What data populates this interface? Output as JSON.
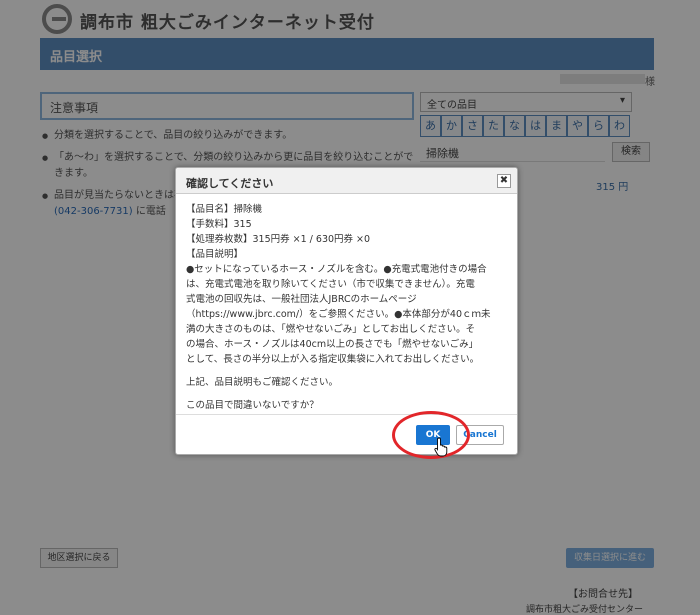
{
  "header": {
    "site_title": "調布市 粗大ごみインターネット受付"
  },
  "section": {
    "title": "品目選択"
  },
  "user": {
    "suffix": "様"
  },
  "notice": {
    "title": "注意事項",
    "bullets": [
      "分類を選択することで、品目の絞り込みができます。",
      "「あ〜わ」を選択することで、分類の絞り込みから更に品目を絞り込むことができます。",
      "品目が見当たらないときは事"
    ],
    "phone": "(042-306-7731)",
    "phone_suffix": "に電話"
  },
  "filter": {
    "category": "全ての品目",
    "kana": [
      "あ",
      "か",
      "さ",
      "た",
      "な",
      "は",
      "ま",
      "や",
      "ら",
      "わ"
    ],
    "search_value": "掃除機",
    "search_button": "検索",
    "price": "315 円"
  },
  "footer": {
    "back_button": "地区選択に戻る",
    "next_button": "収集日選択に進む",
    "contact_title": "【お問合せ先】",
    "contact_name": "調布市粗大ごみ受付センター"
  },
  "dialog": {
    "title": "確認してください",
    "item_name": "【品目名】掃除機",
    "fee": "【手数料】315",
    "tickets": "【処理券枚数】315円券 ×1 / 630円券 ×0",
    "desc_label": "【品目説明】",
    "desc_lines": [
      "●セットになっているホース・ノズルを含む。●充電式電池付きの場合",
      "は、充電式電池を取り除いてください（市で収集できません）。充電",
      "式電池の回収先は、一般社団法人JBRCのホームページ",
      "（https://www.jbrc.com/）をご参照ください。●本体部分が40ｃｍ未",
      "満の大きさのものは、「燃やせないごみ」としてお出しください。そ",
      "の場合、ホース・ノズルは40cm以上の長さでも「燃やせないごみ」",
      "として、長さの半分以上が入る指定収集袋に入れてお出しください。"
    ],
    "confirm_desc": "上記、品目説明もご確認ください。",
    "question": "この品目で間違いないですか？",
    "ok": "OK",
    "cancel": "Cancel"
  },
  "colors": {
    "accent": "#1976d2",
    "highlight": "#e2262a",
    "section_bar": "#5d8ec2"
  }
}
